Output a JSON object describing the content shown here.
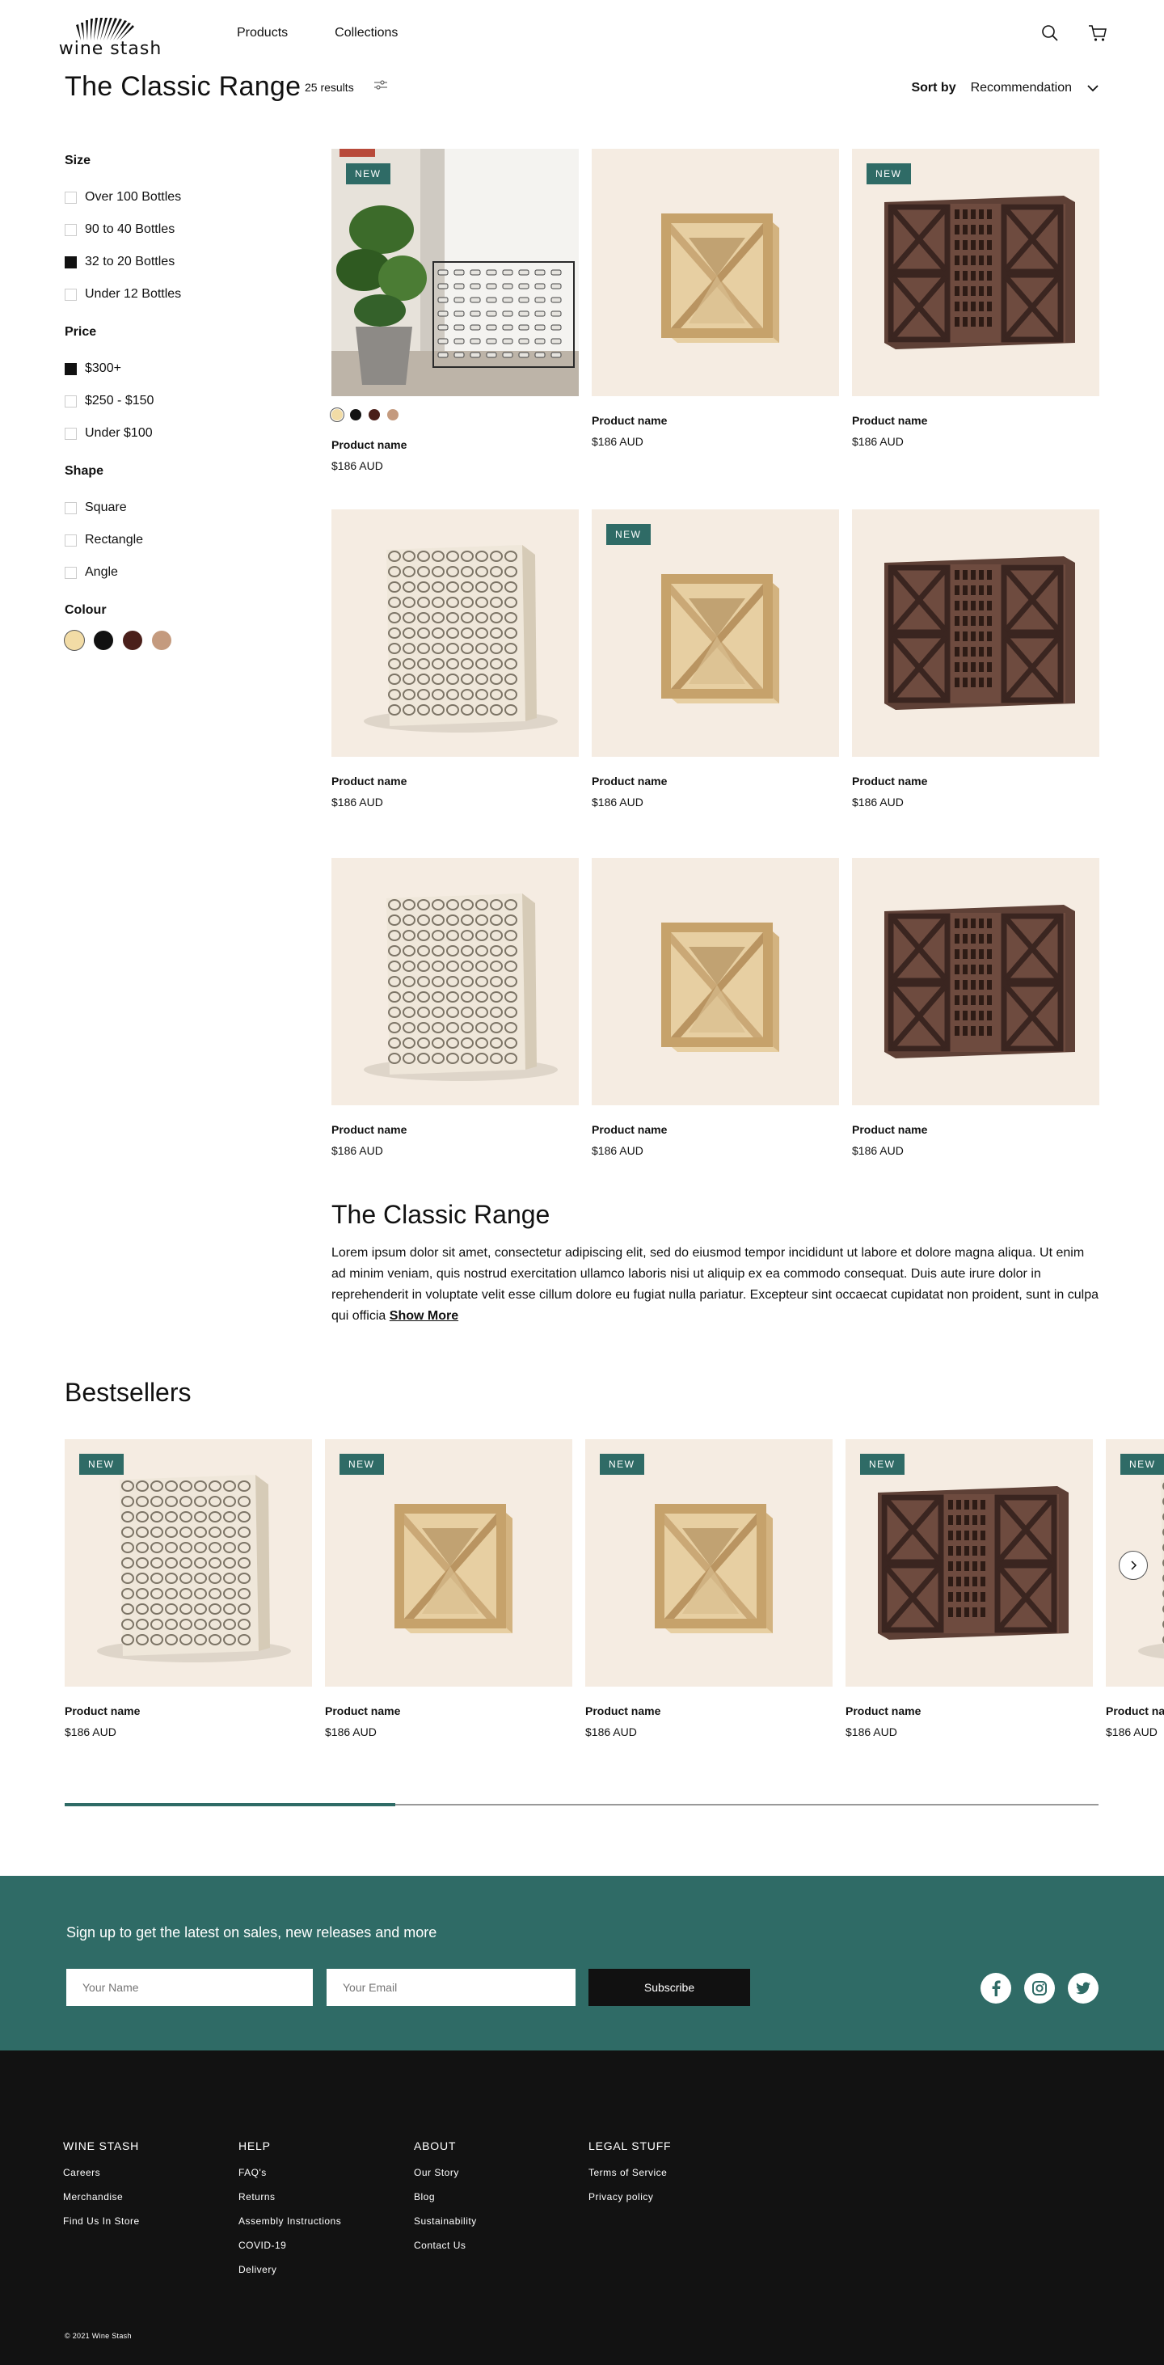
{
  "header": {
    "logo_text": "wine stash",
    "nav": [
      "Products",
      "Collections"
    ]
  },
  "listing": {
    "title": "The Classic Range",
    "results": "25 results",
    "sort_label": "Sort by",
    "sort_value": "Recommendation"
  },
  "filters": {
    "size": {
      "title": "Size",
      "options": [
        {
          "label": "Over 100 Bottles",
          "checked": false
        },
        {
          "label": "90 to 40 Bottles",
          "checked": false
        },
        {
          "label": "32 to 20 Bottles",
          "checked": true
        },
        {
          "label": "Under 12 Bottles",
          "checked": false
        }
      ]
    },
    "price": {
      "title": "Price",
      "options": [
        {
          "label": "$300+",
          "checked": true
        },
        {
          "label": "$250 - $150",
          "checked": false
        },
        {
          "label": "Under $100",
          "checked": false
        }
      ]
    },
    "shape": {
      "title": "Shape",
      "options": [
        {
          "label": "Square",
          "checked": false
        },
        {
          "label": "Rectangle",
          "checked": false
        },
        {
          "label": "Angle",
          "checked": false
        }
      ]
    },
    "colour": {
      "title": "Colour",
      "swatches": [
        "#f2dca6",
        "#111111",
        "#4a1f1a",
        "#c49a7e"
      ]
    }
  },
  "products": [
    {
      "name": "Product name",
      "price": "$186 AUD",
      "badge": "NEW",
      "image": "lifestyle-metal-rack",
      "swatches": [
        "#f2dca6",
        "#111111",
        "#4a1f1a",
        "#c49a7e"
      ]
    },
    {
      "name": "Product name",
      "price": "$186 AUD",
      "badge": "",
      "image": "wood-x-cube"
    },
    {
      "name": "Product name",
      "price": "$186 AUD",
      "badge": "NEW",
      "image": "dark-wood-cabinet"
    },
    {
      "name": "Product name",
      "price": "$186 AUD",
      "badge": "",
      "image": "metal-grid-rack"
    },
    {
      "name": "Product name",
      "price": "$186 AUD",
      "badge": "NEW",
      "image": "wood-x-cube"
    },
    {
      "name": "Product name",
      "price": "$186 AUD",
      "badge": "",
      "image": "dark-wood-cabinet"
    },
    {
      "name": "Product name",
      "price": "$186 AUD",
      "badge": "",
      "image": "metal-grid-rack"
    },
    {
      "name": "Product name",
      "price": "$186 AUD",
      "badge": "",
      "image": "wood-x-cube"
    },
    {
      "name": "Product name",
      "price": "$186 AUD",
      "badge": "",
      "image": "dark-wood-cabinet"
    }
  ],
  "description": {
    "title": "The Classic Range",
    "text": "Lorem ipsum dolor sit amet, consectetur adipiscing elit, sed do eiusmod tempor incididunt ut labore et dolore magna aliqua. Ut enim ad minim veniam, quis nostrud exercitation ullamco laboris nisi ut aliquip ex ea commodo consequat. Duis aute irure dolor in reprehenderit in voluptate velit esse cillum dolore eu fugiat nulla pariatur. Excepteur sint occaecat cupidatat non proident, sunt in culpa qui officia",
    "show_more": "Show More"
  },
  "bestsellers": {
    "title": "Bestsellers",
    "items": [
      {
        "name": "Product name",
        "price": "$186 AUD",
        "badge": "NEW",
        "image": "metal-grid-rack"
      },
      {
        "name": "Product name",
        "price": "$186 AUD",
        "badge": "NEW",
        "image": "wood-x-cube"
      },
      {
        "name": "Product name",
        "price": "$186 AUD",
        "badge": "NEW",
        "image": "wood-x-cube"
      },
      {
        "name": "Product name",
        "price": "$186 AUD",
        "badge": "NEW",
        "image": "dark-wood-cabinet"
      },
      {
        "name": "Product name",
        "price": "$186 AUD",
        "badge": "NEW",
        "image": "metal-grid-rack"
      }
    ],
    "scroll_progress": 0.32
  },
  "newsletter": {
    "title": "Sign up to get the latest on sales, new releases and more",
    "name_placeholder": "Your Name",
    "email_placeholder": "Your Email",
    "button": "Subscribe"
  },
  "footer": {
    "columns": [
      {
        "title": "WINE STASH",
        "links": [
          "Careers",
          "Merchandise",
          "Find Us In Store"
        ]
      },
      {
        "title": "HELP",
        "links": [
          "FAQ's",
          "Returns",
          "Assembly Instructions",
          "COVID-19",
          "Delivery"
        ]
      },
      {
        "title": "ABOUT",
        "links": [
          "Our Story",
          "Blog",
          "Sustainability",
          "Contact Us"
        ]
      },
      {
        "title": "LEGAL STUFF",
        "links": [
          "Terms of Service",
          "Privacy policy"
        ]
      }
    ],
    "copyright": "© 2021 Wine Stash"
  },
  "colors": {
    "accent": "#2f6b66",
    "card_bg": "#f5ece2",
    "footer_bg": "#121212"
  }
}
